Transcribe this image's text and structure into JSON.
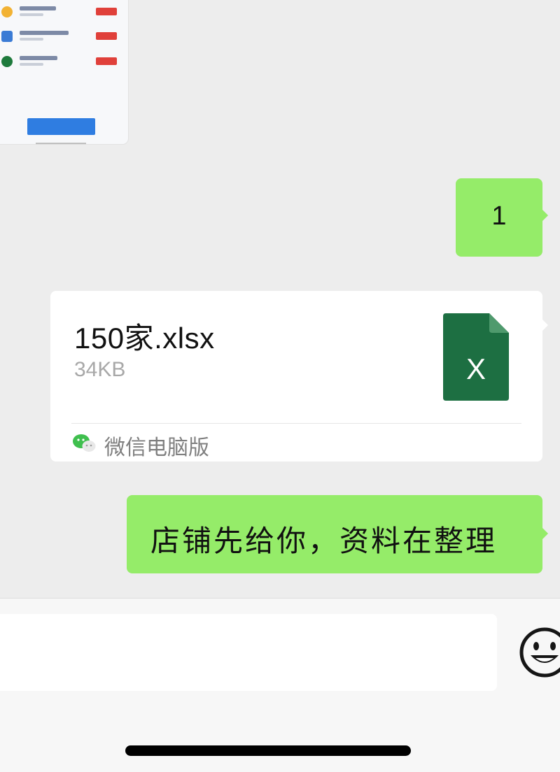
{
  "messages": [
    {
      "type": "image",
      "from": "other",
      "content": "screenshot-thumbnail"
    },
    {
      "type": "text",
      "from": "me",
      "text": "1"
    },
    {
      "type": "file",
      "from": "me",
      "file_name": "150家.xlsx",
      "file_size": "34KB",
      "file_icon": "excel-x-icon",
      "file_icon_letter": "X",
      "source": "微信电脑版"
    },
    {
      "type": "text",
      "from": "me",
      "text": "店铺先给你，资料在整理"
    }
  ],
  "input_bar": {
    "emoji_icon": "smiley-icon"
  },
  "colors": {
    "chat_bg": "#ededed",
    "my_bubble": "#95ec69",
    "file_card": "#ffffff",
    "excel_green": "#1d6f42"
  }
}
